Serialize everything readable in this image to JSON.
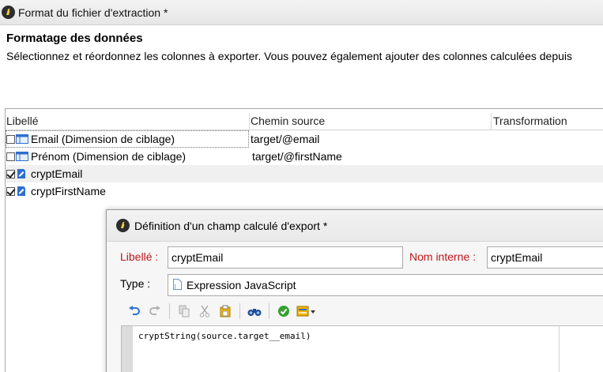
{
  "window": {
    "title": "Format du fichier d'extraction *"
  },
  "section": {
    "heading": "Formatage des données",
    "description": "Sélectionnez et réordonnez les colonnes à exporter. Vous pouvez également ajouter des colonnes calculées depuis"
  },
  "grid": {
    "columns": [
      "Libellé",
      "Chemin source",
      "Transformation"
    ],
    "rows": [
      {
        "checked": false,
        "icon": "column-icon",
        "label": "Email (Dimension de ciblage)",
        "path": "target/@email"
      },
      {
        "checked": false,
        "icon": "column-icon",
        "label": "Prénom (Dimension de ciblage)",
        "path": "target/@firstName"
      },
      {
        "checked": true,
        "icon": "calculated-field-icon",
        "label": "cryptEmail",
        "path": ""
      },
      {
        "checked": true,
        "icon": "calculated-field-icon",
        "label": "cryptFirstName",
        "path": ""
      }
    ]
  },
  "dialog": {
    "title": "Définition d'un champ calculé d'export *",
    "label_caption": "Libellé :",
    "label_value": "cryptEmail",
    "internal_name_caption": "Nom interne :",
    "internal_name_value": "cryptEmail",
    "type_caption": "Type :",
    "type_value": "Expression JavaScript",
    "code": "cryptString(source.target__email)"
  },
  "colors": {
    "required_label": "#c0161c",
    "alt_row": "#f0f0f0",
    "icon_blue": "#2f6fd0"
  }
}
